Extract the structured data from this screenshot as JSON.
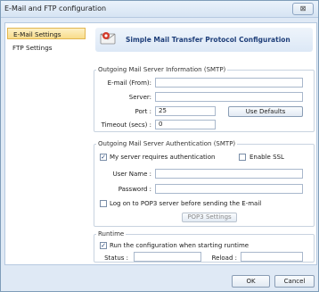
{
  "window": {
    "title": "E-Mail and FTP configuration",
    "close_glyph": "⊠"
  },
  "sidebar": {
    "items": [
      {
        "label": "E-Mail Settings",
        "selected": true
      },
      {
        "label": "FTP Settings",
        "selected": false
      }
    ]
  },
  "header": {
    "title": "Simple Mail Transfer Protocol Configuration",
    "icon": "mail-icon"
  },
  "smtp_info": {
    "group_label": "Outgoing Mail Server Information (SMTP)",
    "email_label": "E-mail (From):",
    "email_value": "",
    "server_label": "Server:",
    "server_value": "",
    "port_label": "Port :",
    "port_value": "25",
    "timeout_label": "Timeout (secs) :",
    "timeout_value": "0",
    "defaults_button": "Use Defaults"
  },
  "smtp_auth": {
    "group_label": "Outgoing Mail Server Authentication (SMTP)",
    "requires_auth_label": "My server requires authentication",
    "requires_auth_checked": true,
    "ssl_label": "Enable SSL",
    "ssl_checked": false,
    "username_label": "User Name :",
    "username_value": "",
    "password_label": "Password :",
    "password_value": "",
    "pop3_label": "Log on to POP3 server before sending the E-mail",
    "pop3_checked": false,
    "pop3_button": "POP3 Settings"
  },
  "runtime": {
    "group_label": "Runtime",
    "run_label": "Run the configuration when starting runtime",
    "run_checked": true,
    "status_label": "Status :",
    "status_value": "",
    "reload_label": "Reload :",
    "reload_value": ""
  },
  "footer": {
    "ok_label": "OK",
    "cancel_label": "Cancel"
  },
  "checkmark": "✓"
}
